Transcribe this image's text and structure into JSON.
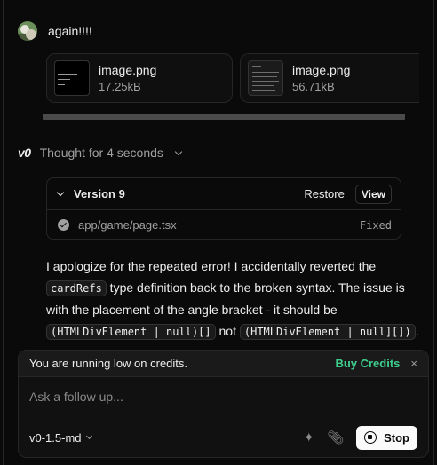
{
  "user_message": {
    "text": "again!!!!"
  },
  "attachments": [
    {
      "name": "image.png",
      "size": "17.25kB"
    },
    {
      "name": "image.png",
      "size": "56.71kB"
    }
  ],
  "assistant": {
    "logo": "v0",
    "thought_label": "Thought for 4 seconds"
  },
  "version_card": {
    "title": "Version 9",
    "restore_label": "Restore",
    "view_label": "View",
    "file": "app/game/page.tsx",
    "status": "Fixed"
  },
  "reply": {
    "part1": "I apologize for the repeated error! I accidentally reverted the ",
    "code1": "cardRefs",
    "part2": " type definition back to the broken syntax. The issue is with the placement of the angle bracket - it should be ",
    "code2": "(HTMLDivElement | null)[]",
    "part3": " not ",
    "code3": "(HTMLDivElement | null][])",
    "part4": ". This fix should resolve the runtime error once and for all."
  },
  "composer": {
    "credits_text": "You are running low on credits.",
    "buy_credits_label": "Buy Credits",
    "close_label": "×",
    "placeholder": "Ask a follow up...",
    "model": "v0-1.5-md",
    "stop_label": "Stop"
  },
  "colors": {
    "background": "#0a0a0a",
    "accent_green": "#3ecf8e",
    "text_muted": "#a1a1a1"
  }
}
